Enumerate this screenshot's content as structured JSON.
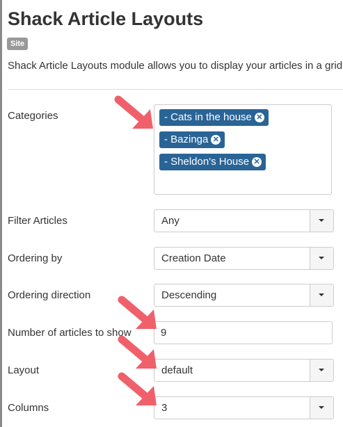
{
  "page": {
    "title": "Shack Article Layouts",
    "badge": "Site",
    "description": "Shack Article Layouts module allows you to display your articles in a grid"
  },
  "fields": {
    "categories": {
      "label": "Categories",
      "tags": [
        "- Cats in the house",
        "- Bazinga",
        "- Sheldon's House"
      ]
    },
    "filter_articles": {
      "label": "Filter Articles",
      "value": "Any"
    },
    "ordering_by": {
      "label": "Ordering by",
      "value": "Creation Date"
    },
    "ordering_direction": {
      "label": "Ordering direction",
      "value": "Descending"
    },
    "number_of_articles": {
      "label": "Number of articles to show",
      "value": "9"
    },
    "layout": {
      "label": "Layout",
      "value": "default"
    },
    "columns": {
      "label": "Columns",
      "value": "3"
    }
  },
  "colors": {
    "tag_background": "#2a6496",
    "annotation_arrow": "#f0606a"
  },
  "icons": [
    "remove-tag-icon",
    "caret-down-icon",
    "annotation-arrow-icon"
  ]
}
